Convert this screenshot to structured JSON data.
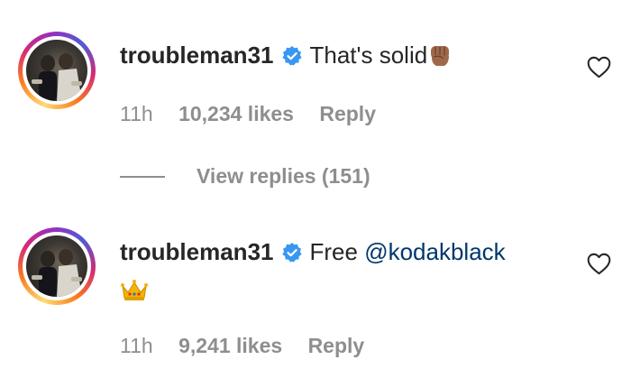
{
  "comments": [
    {
      "username": "troubleman31",
      "text": "That's solid",
      "emoji": "fist-emoji",
      "time": "11h",
      "likes": "10,234 likes",
      "reply": "Reply"
    },
    {
      "username": "troubleman31",
      "text": "Free ",
      "mention": "@kodakblack",
      "emoji": "crown-emoji",
      "time": "11h",
      "likes": "9,241 likes",
      "reply": "Reply"
    }
  ],
  "view_replies": "View replies (151)",
  "colors": {
    "mention": "#00376b",
    "meta": "#8e8e8e",
    "verified": "#3897f0",
    "text": "#262626"
  }
}
